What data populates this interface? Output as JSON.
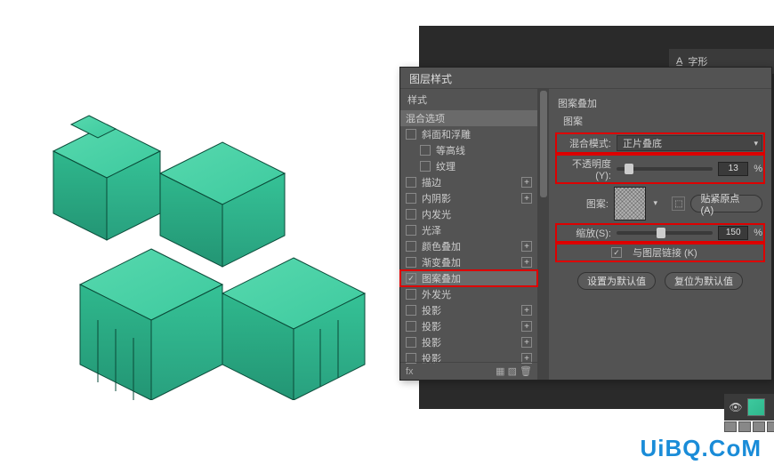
{
  "tab": {
    "label": "字形"
  },
  "dialog": {
    "title": "图层样式",
    "styles_header": "样式",
    "blend_options": "混合选项",
    "fx": [
      {
        "label": "斜面和浮雕",
        "checked": false,
        "plus": false
      },
      {
        "label": "等高线",
        "checked": false,
        "plus": false,
        "indent": true
      },
      {
        "label": "纹理",
        "checked": false,
        "plus": false,
        "indent": true
      },
      {
        "label": "描边",
        "checked": false,
        "plus": true
      },
      {
        "label": "内阴影",
        "checked": false,
        "plus": true
      },
      {
        "label": "内发光",
        "checked": false,
        "plus": false
      },
      {
        "label": "光泽",
        "checked": false,
        "plus": false
      },
      {
        "label": "颜色叠加",
        "checked": false,
        "plus": true
      },
      {
        "label": "渐变叠加",
        "checked": false,
        "plus": true
      },
      {
        "label": "图案叠加",
        "checked": true,
        "plus": false,
        "selected": true,
        "highlight": true
      },
      {
        "label": "外发光",
        "checked": false,
        "plus": false
      },
      {
        "label": "投影",
        "checked": false,
        "plus": true
      },
      {
        "label": "投影",
        "checked": false,
        "plus": true
      },
      {
        "label": "投影",
        "checked": false,
        "plus": true
      },
      {
        "label": "投影",
        "checked": false,
        "plus": true
      }
    ],
    "fx_footer": {
      "fx": "fx",
      "actions": "▦ ▨ 🗑"
    },
    "options": {
      "section_title": "图案叠加",
      "group_title": "图案",
      "blend_mode_label": "混合模式:",
      "blend_mode_value": "正片叠底",
      "opacity_label": "不透明度(Y):",
      "opacity_value": "13",
      "opacity_unit": "%",
      "pattern_label": "图案:",
      "snap_origin": "贴紧原点 (A)",
      "scale_label": "缩放(S):",
      "scale_value": "150",
      "scale_unit": "%",
      "link_label": "与图层链接 (K)",
      "link_checked": true,
      "set_default": "设置为默认值",
      "reset_default": "复位为默认值"
    }
  },
  "watermark": "UiBQ.CoM"
}
